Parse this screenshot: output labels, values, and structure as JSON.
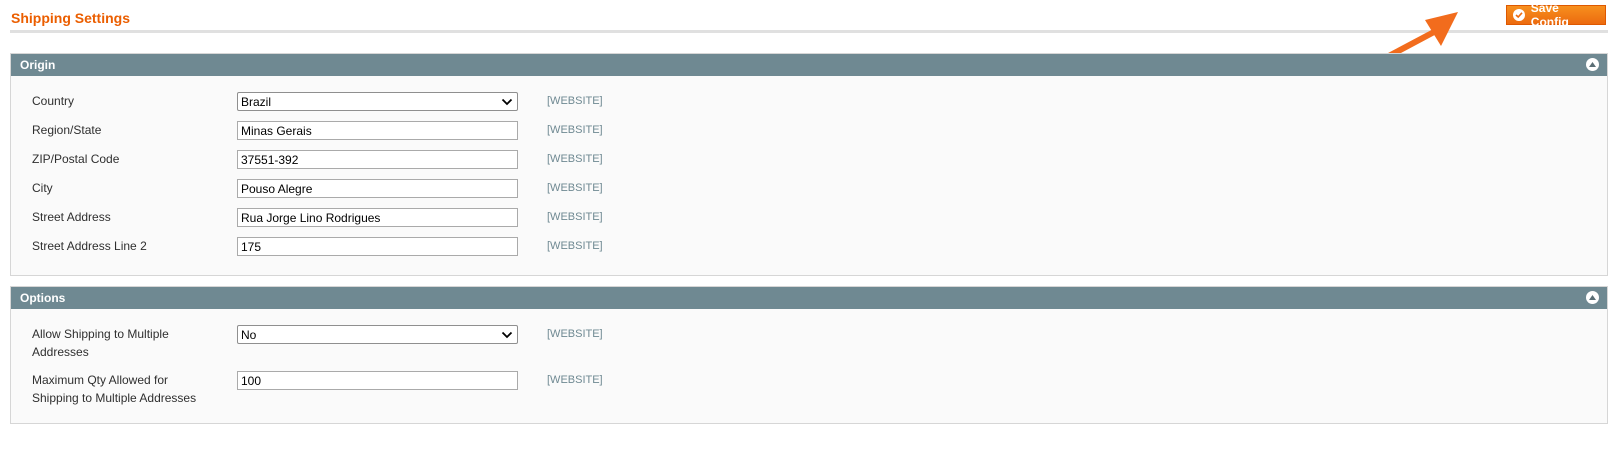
{
  "page": {
    "title": "Shipping Settings",
    "save_button_label": "Save Config"
  },
  "colors": {
    "accent": "#eb5e00",
    "button": "#f18200",
    "section_header": "#6f8992",
    "scope_text": "#6f8992",
    "annotation_arrow": "#f26c1d"
  },
  "icons": {
    "save": "check-circle-icon",
    "collapse": "chevron-up-circle-icon",
    "select": "chevron-down-icon",
    "annotation": "arrow-icon"
  },
  "sections": {
    "origin": {
      "title": "Origin",
      "rows": [
        {
          "label": "Country",
          "value": "Brazil",
          "type": "select",
          "scope": "[WEBSITE]"
        },
        {
          "label": "Region/State",
          "value": "Minas Gerais",
          "type": "text",
          "scope": "[WEBSITE]"
        },
        {
          "label": "ZIP/Postal Code",
          "value": "37551-392",
          "type": "text",
          "scope": "[WEBSITE]"
        },
        {
          "label": "City",
          "value": "Pouso Alegre",
          "type": "text",
          "scope": "[WEBSITE]"
        },
        {
          "label": "Street Address",
          "value": "Rua Jorge Lino Rodrigues",
          "type": "text",
          "scope": "[WEBSITE]"
        },
        {
          "label": "Street Address Line 2",
          "value": "175",
          "type": "text",
          "scope": "[WEBSITE]"
        }
      ]
    },
    "options": {
      "title": "Options",
      "rows": [
        {
          "label_line1": "Allow Shipping to Multiple",
          "label_line2": "Addresses",
          "value": "No",
          "type": "select",
          "scope": "[WEBSITE]"
        },
        {
          "label_line1": "Maximum Qty Allowed for",
          "label_line2": "Shipping to Multiple Addresses",
          "value": "100",
          "type": "text",
          "scope": "[WEBSITE]"
        }
      ]
    }
  }
}
